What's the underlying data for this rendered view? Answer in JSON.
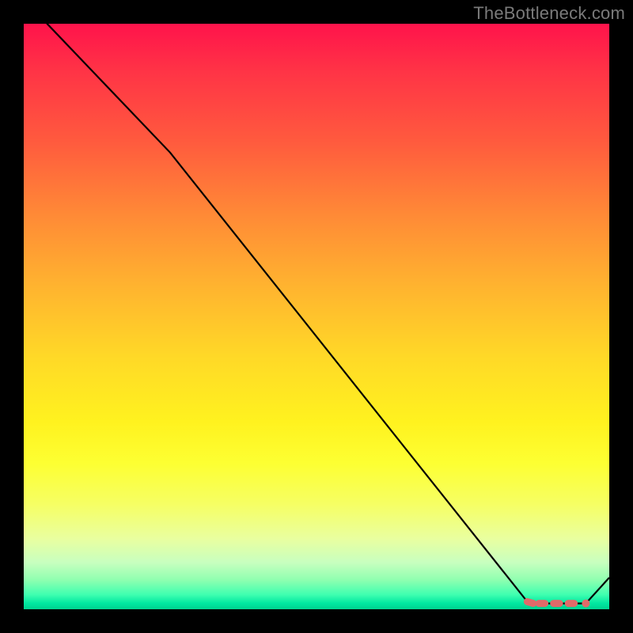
{
  "attribution": "TheBottleneck.com",
  "chart_data": {
    "type": "line",
    "x": [
      0.0,
      0.04,
      0.25,
      0.86,
      0.87,
      0.89,
      0.91,
      0.96,
      1.0
    ],
    "y": [
      1.06,
      1.0,
      0.78,
      0.013,
      0.01,
      0.01,
      0.01,
      0.01,
      0.054
    ],
    "xlim": [
      0,
      1
    ],
    "ylim": [
      0,
      1
    ],
    "markers": {
      "segments": [
        {
          "x0": 0.86,
          "y0": 0.013,
          "x1": 0.87,
          "y1": 0.01
        },
        {
          "x0": 0.88,
          "y0": 0.01,
          "x1": 0.89,
          "y1": 0.01
        },
        {
          "x0": 0.905,
          "y0": 0.01,
          "x1": 0.915,
          "y1": 0.01
        },
        {
          "x0": 0.93,
          "y0": 0.01,
          "x1": 0.94,
          "y1": 0.01
        }
      ],
      "points": [
        {
          "x": 0.96,
          "y": 0.01
        }
      ],
      "color": "#e16a69"
    },
    "line_color": "#000000",
    "background": "gradient-red-to-green"
  }
}
